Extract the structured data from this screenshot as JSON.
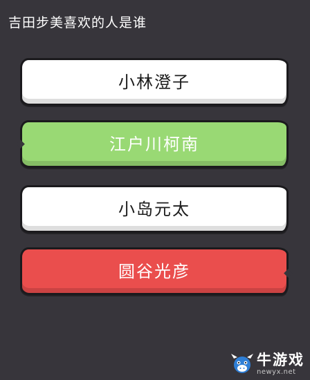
{
  "question": "吉田步美喜欢的人是谁",
  "answers": [
    {
      "label": "小林澄子",
      "state": "neutral"
    },
    {
      "label": "江户川柯南",
      "state": "correct"
    },
    {
      "label": "小岛元太",
      "state": "neutral"
    },
    {
      "label": "圆谷光彦",
      "state": "wrong"
    }
  ],
  "watermark": {
    "name": "牛游戏",
    "url": "newyx.net"
  },
  "colors": {
    "background": "#37353b",
    "neutral": "#ffffff",
    "correct": "#99d974",
    "wrong": "#ea4e4d"
  }
}
